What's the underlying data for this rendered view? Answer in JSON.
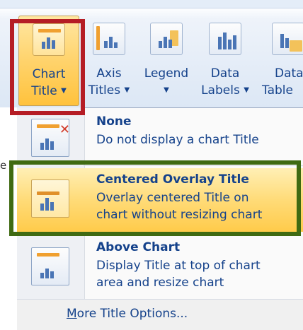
{
  "ribbon": {
    "buttons": [
      {
        "id": "chart-title",
        "line1": "Chart",
        "line2": "Title",
        "arrow": "▼",
        "active": true
      },
      {
        "id": "axis-titles",
        "line1": "Axis",
        "line2": "Titles",
        "arrow": "▼",
        "active": false
      },
      {
        "id": "legend",
        "line1": "Legend",
        "line2": "",
        "arrow": "▼",
        "active": false
      },
      {
        "id": "data-labels",
        "line1": "Data",
        "line2": "Labels",
        "arrow": "▼",
        "active": false
      },
      {
        "id": "data-table",
        "line1": "Data",
        "line2": "Table",
        "arrow": "",
        "active": false
      }
    ]
  },
  "menu": {
    "items": [
      {
        "title": "None",
        "desc1": "Do not display a chart Title",
        "desc2": "",
        "icon": "chart-no-title-icon"
      },
      {
        "title": "Centered Overlay Title",
        "desc1": "Overlay centered Title on",
        "desc2": "chart without resizing chart",
        "icon": "chart-overlay-title-icon"
      },
      {
        "title": "Above Chart",
        "desc1": "Display Title at top of chart",
        "desc2": "area and resize chart",
        "icon": "chart-above-title-icon"
      }
    ],
    "more_first": "M",
    "more_rest": "ore Title Options..."
  },
  "peek": {
    "letter": "e"
  },
  "colors": {
    "highlight_red": "#b51d25",
    "highlight_green": "#3f6a12",
    "accent_text": "#15428b",
    "active_fill": "#ffd36c"
  }
}
